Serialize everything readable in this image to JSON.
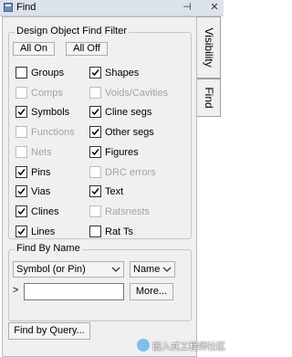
{
  "window": {
    "title": "Find",
    "pin_glyph": "⊣",
    "close_glyph": "✕",
    "icon": "find-window-icon"
  },
  "side_tabs": [
    "Visibility",
    "Find"
  ],
  "filter": {
    "title": "Design Object Find Filter",
    "all_on_label": "All On",
    "all_off_label": "All Off",
    "left": [
      {
        "label": "Groups",
        "checked": false,
        "enabled": true
      },
      {
        "label": "Comps",
        "checked": false,
        "enabled": false
      },
      {
        "label": "Symbols",
        "checked": true,
        "enabled": true
      },
      {
        "label": "Functions",
        "checked": false,
        "enabled": false
      },
      {
        "label": "Nets",
        "checked": false,
        "enabled": false
      },
      {
        "label": "Pins",
        "checked": true,
        "enabled": true
      },
      {
        "label": "Vias",
        "checked": true,
        "enabled": true
      },
      {
        "label": "Clines",
        "checked": true,
        "enabled": true
      },
      {
        "label": "Lines",
        "checked": true,
        "enabled": true
      }
    ],
    "right": [
      {
        "label": "Shapes",
        "checked": true,
        "enabled": true
      },
      {
        "label": "Voids/Cavities",
        "checked": false,
        "enabled": false
      },
      {
        "label": "Cline segs",
        "checked": true,
        "enabled": true
      },
      {
        "label": "Other segs",
        "checked": true,
        "enabled": true
      },
      {
        "label": "Figures",
        "checked": true,
        "enabled": true
      },
      {
        "label": "DRC errors",
        "checked": false,
        "enabled": false
      },
      {
        "label": "Text",
        "checked": true,
        "enabled": true
      },
      {
        "label": "Ratsnests",
        "checked": false,
        "enabled": false
      },
      {
        "label": "Rat Ts",
        "checked": false,
        "enabled": true
      }
    ]
  },
  "find_by_name": {
    "title": "Find By Name",
    "type_value": "Symbol (or Pin)",
    "mode_value": "Name",
    "prompt": ">",
    "input_value": "",
    "more_label": "More..."
  },
  "find_by_query_label": "Find by Query...",
  "watermark": {
    "text": "嵌入式工程师社区",
    "logo": "wechat-logo"
  },
  "colors": {
    "checkmark": "#000000",
    "disabled_text": "#a3a3a3",
    "titlebar": "#dbe2ec"
  }
}
